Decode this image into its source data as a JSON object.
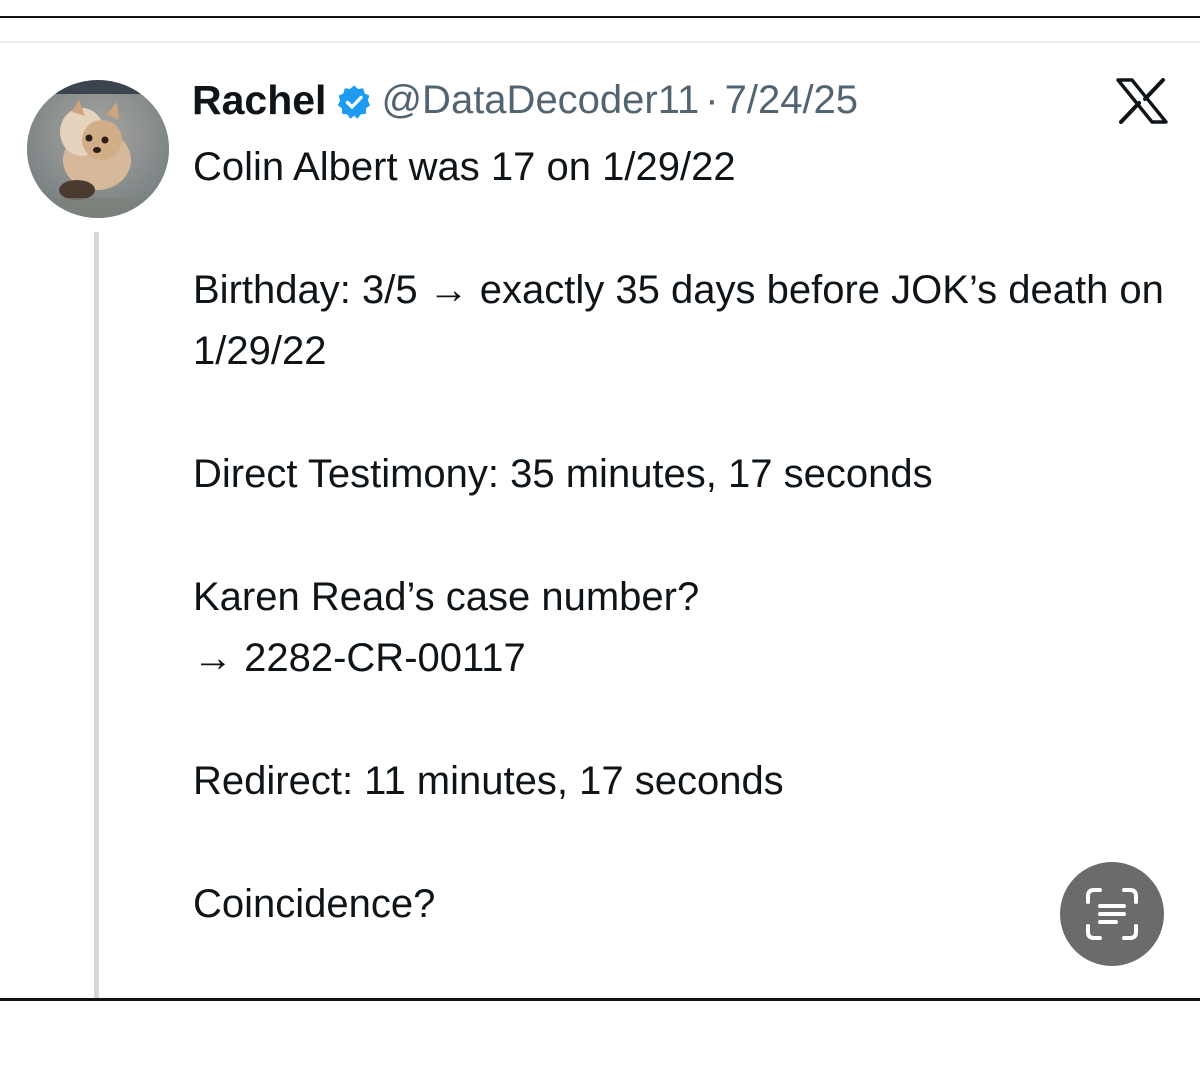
{
  "tweet": {
    "author_name": "Rachel",
    "handle": "@DataDecoder11",
    "separator": "·",
    "date": "7/24/25",
    "verified": true,
    "paragraphs": [
      "Colin Albert was 17 on 1/29/22",
      "Birthday: 3/5 → exactly 35 days before JOK’s death on 1/29/22",
      "Direct Testimony: 35 minutes, 17 seconds",
      "Karen Read’s case number?\n→ 2282-CR-00117",
      "Redirect: 11 minutes, 17 seconds",
      "Coincidence?"
    ]
  },
  "icons": {
    "verified": "verified-badge-icon",
    "platform": "x-logo-icon",
    "scan": "text-scan-icon"
  },
  "colors": {
    "verified_blue": "#1d9bf0",
    "text_primary": "#0f1419",
    "text_secondary": "#536471",
    "thread_line": "#cfd9de",
    "scan_button_bg": "#6b6b6b"
  }
}
